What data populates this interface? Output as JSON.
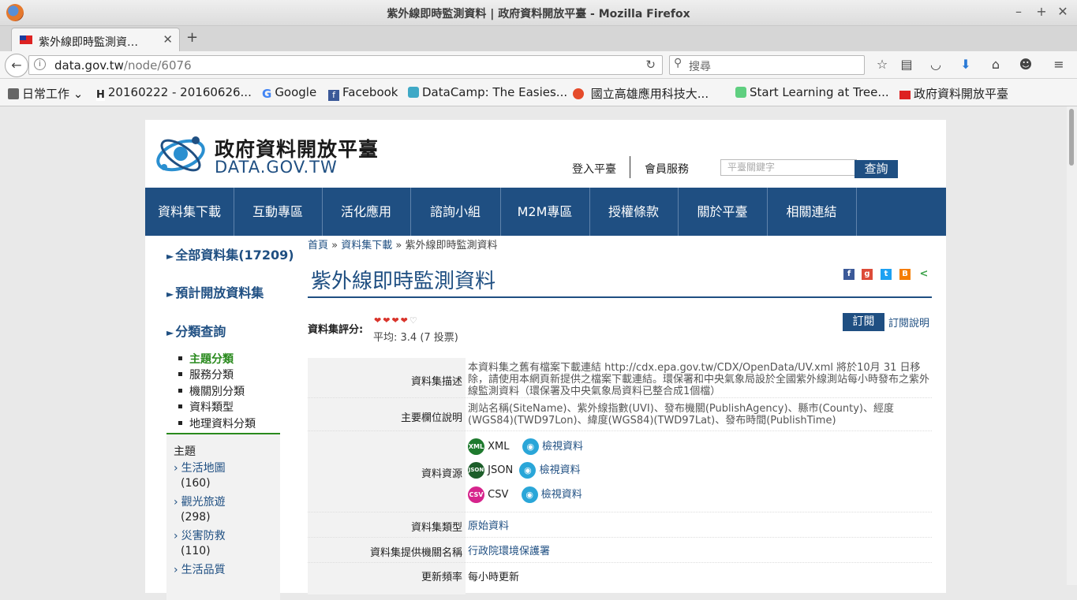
{
  "window": {
    "title": "紫外線即時監測資料 | 政府資料開放平臺 - Mozilla Firefox"
  },
  "tab": {
    "label": "紫外線即時監測資…"
  },
  "address": {
    "domain": "data.gov.tw",
    "path": "/node/6076"
  },
  "search": {
    "placeholder": "搜尋"
  },
  "bookmarks": [
    {
      "label": "日常工作",
      "icon": "folder-icon"
    },
    {
      "label": "20160222 - 20160626...",
      "icon": "h-icon"
    },
    {
      "label": "Google",
      "icon": "google-icon"
    },
    {
      "label": "Facebook",
      "icon": "facebook-icon"
    },
    {
      "label": "DataCamp: The Easies...",
      "icon": "datacamp-icon"
    },
    {
      "label": "國立高雄應用科技大...",
      "icon": "kuas-icon"
    },
    {
      "label": "Start Learning at Tree...",
      "icon": "treehouse-icon"
    },
    {
      "label": "政府資料開放平臺",
      "icon": "flag-icon"
    }
  ],
  "site": {
    "logo_cn": "政府資料開放平臺",
    "logo_en": "DATA.GOV.TW",
    "login": "登入平臺",
    "member": "會員服務",
    "keyword_placeholder": "平臺關鍵字",
    "search_btn": "查詢",
    "nav": [
      "資料集下載",
      "互動專區",
      "活化應用",
      "諮詢小組",
      "M2M專區",
      "授權條款",
      "關於平臺",
      "相關連結"
    ]
  },
  "sidebar": {
    "all": "全部資料集(17209)",
    "planned": "預計開放資料集",
    "classify": "分類查詢",
    "categories": [
      "主題分類",
      "服務分類",
      "機關別分類",
      "資料類型",
      "地理資料分類"
    ],
    "topic_title": "主題",
    "topics": [
      {
        "name": "生活地圖",
        "count": "(160)"
      },
      {
        "name": "觀光旅遊",
        "count": "(298)"
      },
      {
        "name": "災害防救",
        "count": "(110)"
      },
      {
        "name": "生活品質",
        "count": ""
      }
    ]
  },
  "breadcrumb": {
    "home": "首頁",
    "sep": "»",
    "parent": "資料集下載",
    "current": "紫外線即時監測資料"
  },
  "dataset": {
    "title": "紫外線即時監測資料",
    "rating_label": "資料集評分:",
    "rating_avg": "平均: 3.4 (7 投票)",
    "rating_value": 3.4,
    "subscribe": "訂閱",
    "subscribe_help": "訂閱說明",
    "rows": {
      "desc_label": "資料集描述",
      "desc_value": "本資料集之舊有檔案下載連結 http://cdx.epa.gov.tw/CDX/OpenData/UV.xml 將於10月 31 日移除，請使用本網頁新提供之檔案下載連結。環保署和中央氣象局設於全國紫外線測站每小時發布之紫外線監測資料（環保署及中央氣象局資料已整合成1個檔）",
      "fields_label": "主要欄位說明",
      "fields_value": "測站名稱(SiteName)、紫外線指數(UVI)、發布機關(PublishAgency)、縣市(County)、經度(WGS84)(TWD97Lon)、緯度(WGS84)(TWD97Lat)、發布時間(PublishTime)",
      "resources_label": "資料資源",
      "resources": [
        {
          "format": "XML",
          "badge": "XML",
          "view": "檢視資料",
          "color": "#1e7a2e"
        },
        {
          "format": "JSON",
          "badge": "JSON",
          "view": "檢視資料",
          "color": "#1d5e2a"
        },
        {
          "format": "CSV",
          "badge": "CSV",
          "view": "檢視資料",
          "color": "#d6248c"
        }
      ],
      "type_label": "資料集類型",
      "type_value": "原始資料",
      "agency_label": "資料集提供機關名稱",
      "agency_value": "行政院環境保護署",
      "freq_label": "更新頻率",
      "freq_value": "每小時更新"
    }
  }
}
